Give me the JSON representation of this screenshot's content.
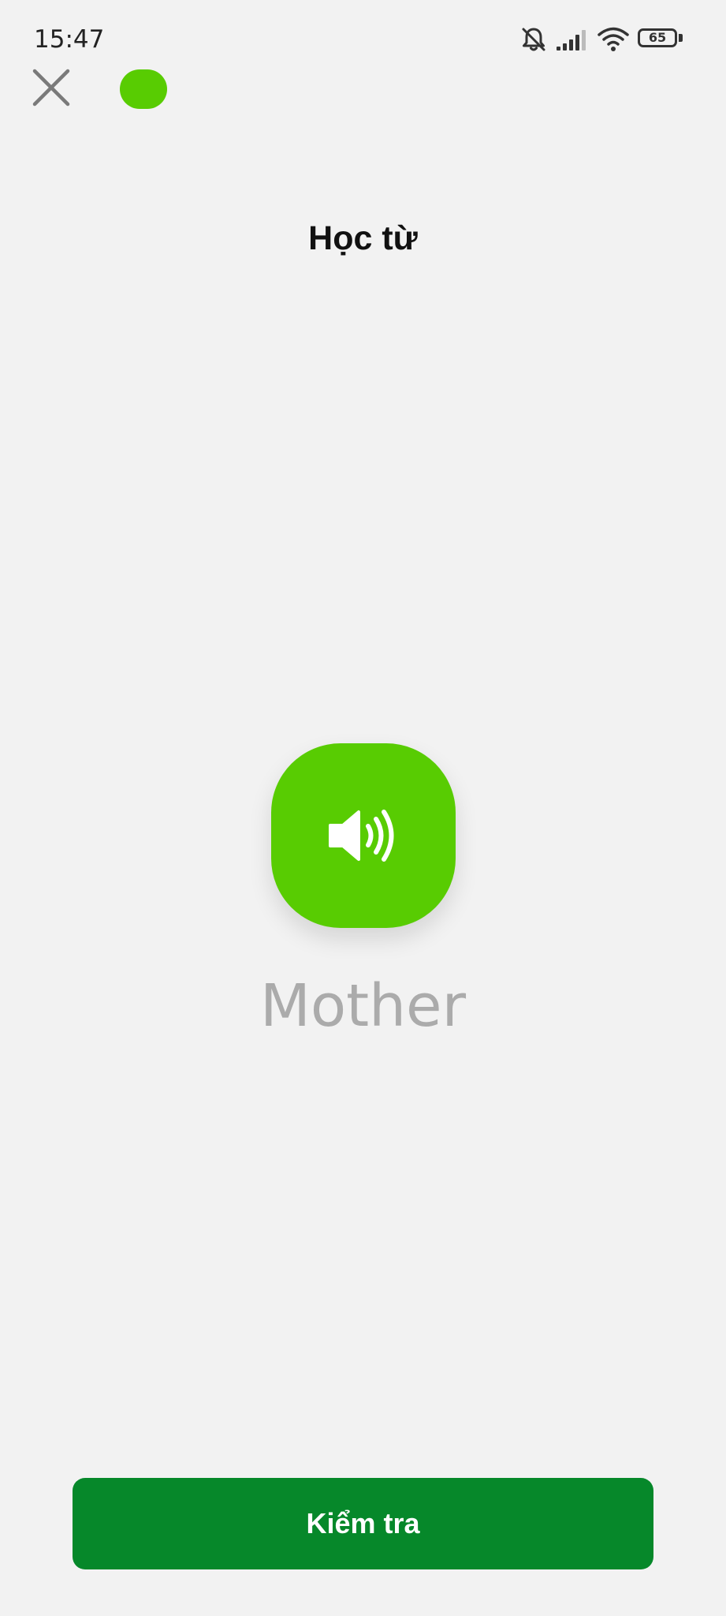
{
  "status_bar": {
    "time": "15:47",
    "battery_level": "65",
    "icons": [
      "bell-off-icon",
      "signal-icon",
      "wifi-icon",
      "battery-icon"
    ]
  },
  "header": {
    "close_icon": "close-icon",
    "progress": {
      "color": "#58cc02"
    }
  },
  "main": {
    "title": "Học từ",
    "audio_icon": "speaker-icon",
    "word": "Mother"
  },
  "footer": {
    "check_label": "Kiểm tra"
  },
  "colors": {
    "background": "#f2f2f2",
    "accent_green": "#58cc02",
    "button_green": "#06882a",
    "word_gray": "#ababab"
  }
}
